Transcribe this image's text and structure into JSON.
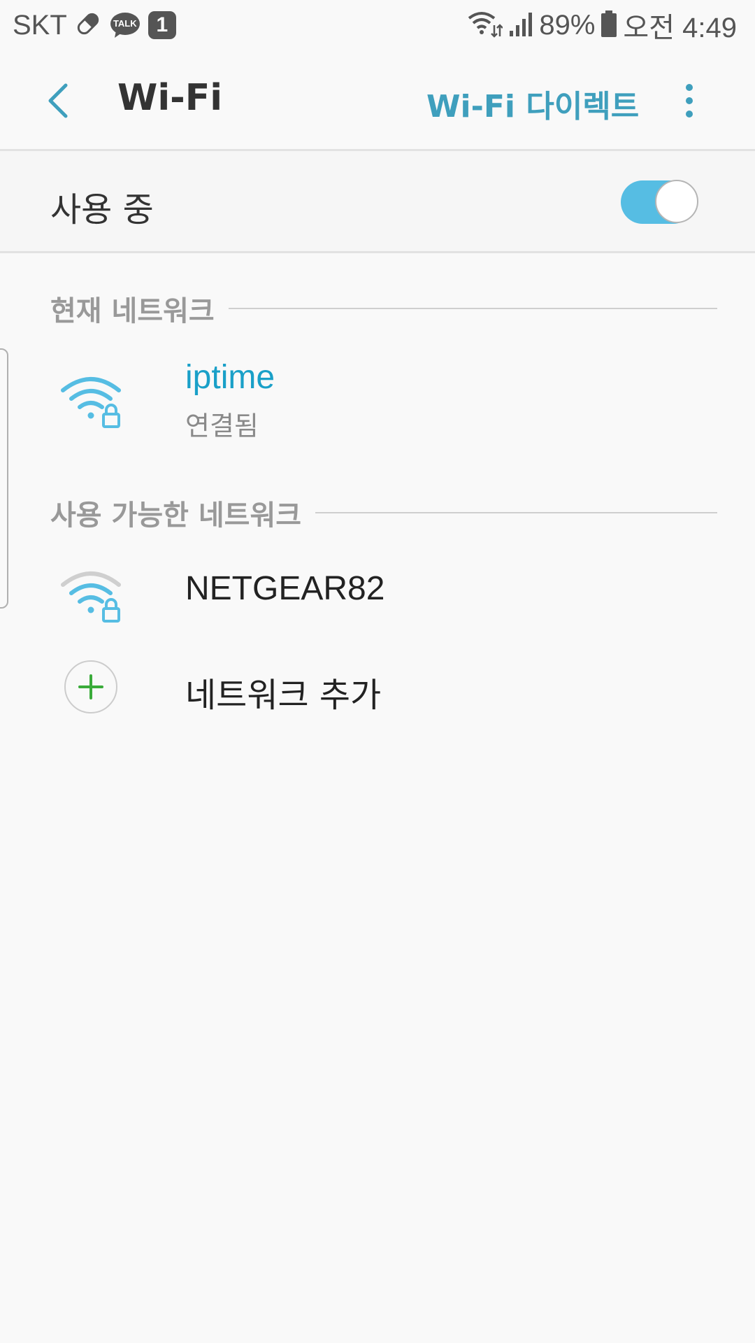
{
  "status_bar": {
    "carrier": "SKT",
    "talk_label": "TALK",
    "notification_count": "1",
    "battery": "89%",
    "time": "오전 4:49"
  },
  "app_bar": {
    "title": "Wi-Fi",
    "action_label": "Wi-Fi 다이렉트"
  },
  "master_switch": {
    "label": "사용 중",
    "on": true
  },
  "sections": {
    "current": "현재 네트워크",
    "available": "사용 가능한 네트워크"
  },
  "current_network": {
    "name": "iptime",
    "status": "연결됨"
  },
  "available_networks": [
    {
      "name": "NETGEAR82"
    }
  ],
  "add_network_label": "네트워크 추가",
  "colors": {
    "accent": "#3f9fbd",
    "toggle_on": "#56bde3",
    "connected_name": "#1aa0c8",
    "add_plus": "#3aab3a"
  },
  "icons": {
    "back": "chevron-left-icon",
    "more": "more-vertical-icon",
    "wifi_secure": "wifi-lock-icon",
    "add": "plus-icon"
  }
}
